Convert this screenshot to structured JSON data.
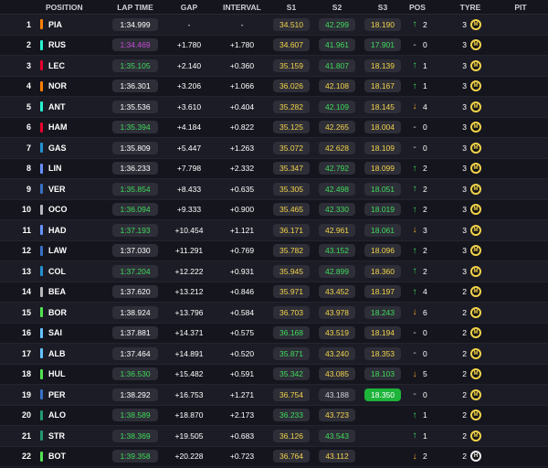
{
  "header": {
    "position": "POSITION",
    "lap_time": "LAP TIME",
    "gap": "GAP",
    "interval": "INTERVAL",
    "s1": "S1",
    "s2": "S2",
    "s3": "S3",
    "pos": "POS",
    "tyre": "TYRE",
    "pit": "PIT"
  },
  "colors": {
    "green": "#3edc5a",
    "yellow": "#f2d34a",
    "purple": "#c74bd9",
    "arrow_up": "#3edc5a",
    "arrow_down": "#f2a72e"
  },
  "rows": [
    {
      "pos": "1",
      "drv": "PIA",
      "team": "#ff8000",
      "lap": "1:34.999",
      "lapc": "white",
      "gap": "-",
      "int": "-",
      "s1": "34.510",
      "s1c": "yellow",
      "s2": "42.299",
      "s2c": "green",
      "s3": "18.190",
      "s3c": "yellow",
      "dir": "up",
      "dp": "2",
      "tyres": "3",
      "tyre": "M"
    },
    {
      "pos": "2",
      "drv": "RUS",
      "team": "#27f4d2",
      "lap": "1:34.469",
      "lapc": "purple",
      "gap": "+1.780",
      "int": "+1.780",
      "s1": "34.607",
      "s1c": "yellow",
      "s2": "41.961",
      "s2c": "green",
      "s3": "17.901",
      "s3c": "green",
      "dir": "none",
      "dp": "0",
      "tyres": "3",
      "tyre": "M"
    },
    {
      "pos": "3",
      "drv": "LEC",
      "team": "#e8002d",
      "lap": "1:35.105",
      "lapc": "green",
      "gap": "+2.140",
      "int": "+0.360",
      "s1": "35.159",
      "s1c": "yellow",
      "s2": "41.807",
      "s2c": "green",
      "s3": "18.139",
      "s3c": "yellow",
      "dir": "up",
      "dp": "1",
      "tyres": "3",
      "tyre": "M"
    },
    {
      "pos": "4",
      "drv": "NOR",
      "team": "#ff8000",
      "lap": "1:36.301",
      "lapc": "white",
      "gap": "+3.206",
      "int": "+1.066",
      "s1": "36.026",
      "s1c": "yellow",
      "s2": "42.108",
      "s2c": "yellow",
      "s3": "18.167",
      "s3c": "yellow",
      "dir": "up",
      "dp": "1",
      "tyres": "3",
      "tyre": "M"
    },
    {
      "pos": "5",
      "drv": "ANT",
      "team": "#27f4d2",
      "lap": "1:35.536",
      "lapc": "white",
      "gap": "+3.610",
      "int": "+0.404",
      "s1": "35.282",
      "s1c": "yellow",
      "s2": "42.109",
      "s2c": "green",
      "s3": "18.145",
      "s3c": "yellow",
      "dir": "down",
      "dp": "4",
      "tyres": "3",
      "tyre": "M"
    },
    {
      "pos": "6",
      "drv": "HAM",
      "team": "#e8002d",
      "lap": "1:35.394",
      "lapc": "green",
      "gap": "+4.184",
      "int": "+0.822",
      "s1": "35.125",
      "s1c": "yellow",
      "s2": "42.265",
      "s2c": "yellow",
      "s3": "18.004",
      "s3c": "yellow",
      "dir": "none",
      "dp": "0",
      "tyres": "3",
      "tyre": "M"
    },
    {
      "pos": "7",
      "drv": "GAS",
      "team": "#2293d1",
      "lap": "1:35.809",
      "lapc": "white",
      "gap": "+5.447",
      "int": "+1.263",
      "s1": "35.072",
      "s1c": "yellow",
      "s2": "42.628",
      "s2c": "yellow",
      "s3": "18.109",
      "s3c": "yellow",
      "dir": "none",
      "dp": "0",
      "tyres": "3",
      "tyre": "M"
    },
    {
      "pos": "8",
      "drv": "LIN",
      "team": "#6692ff",
      "lap": "1:36.233",
      "lapc": "white",
      "gap": "+7.798",
      "int": "+2.332",
      "s1": "35.347",
      "s1c": "yellow",
      "s2": "42.792",
      "s2c": "green",
      "s3": "18.099",
      "s3c": "yellow",
      "dir": "up",
      "dp": "2",
      "tyres": "3",
      "tyre": "M"
    },
    {
      "pos": "9",
      "drv": "VER",
      "team": "#3671c6",
      "lap": "1:35.854",
      "lapc": "green",
      "gap": "+8.433",
      "int": "+0.635",
      "s1": "35.305",
      "s1c": "yellow",
      "s2": "42.498",
      "s2c": "green",
      "s3": "18.051",
      "s3c": "green",
      "dir": "up",
      "dp": "2",
      "tyres": "3",
      "tyre": "M"
    },
    {
      "pos": "10",
      "drv": "OCO",
      "team": "#b6babd",
      "lap": "1:36.094",
      "lapc": "green",
      "gap": "+9.333",
      "int": "+0.900",
      "s1": "35.465",
      "s1c": "yellow",
      "s2": "42.330",
      "s2c": "green",
      "s3": "18.019",
      "s3c": "green",
      "dir": "up",
      "dp": "2",
      "tyres": "3",
      "tyre": "M"
    },
    {
      "pos": "11",
      "drv": "HAD",
      "team": "#6692ff",
      "lap": "1:37.193",
      "lapc": "green",
      "gap": "+10.454",
      "int": "+1.121",
      "s1": "36.171",
      "s1c": "yellow",
      "s2": "42.961",
      "s2c": "yellow",
      "s3": "18.061",
      "s3c": "green",
      "dir": "down",
      "dp": "3",
      "tyres": "3",
      "tyre": "M"
    },
    {
      "pos": "12",
      "drv": "LAW",
      "team": "#3671c6",
      "lap": "1:37.030",
      "lapc": "white",
      "gap": "+11.291",
      "int": "+0.769",
      "s1": "35.782",
      "s1c": "yellow",
      "s2": "43.152",
      "s2c": "green",
      "s3": "18.096",
      "s3c": "yellow",
      "dir": "up",
      "dp": "2",
      "tyres": "3",
      "tyre": "M"
    },
    {
      "pos": "13",
      "drv": "COL",
      "team": "#2293d1",
      "lap": "1:37.204",
      "lapc": "green",
      "gap": "+12.222",
      "int": "+0.931",
      "s1": "35.945",
      "s1c": "yellow",
      "s2": "42.899",
      "s2c": "green",
      "s3": "18.360",
      "s3c": "yellow",
      "dir": "up",
      "dp": "2",
      "tyres": "3",
      "tyre": "M"
    },
    {
      "pos": "14",
      "drv": "BEA",
      "team": "#b6babd",
      "lap": "1:37.620",
      "lapc": "white",
      "gap": "+13.212",
      "int": "+0.846",
      "s1": "35.971",
      "s1c": "yellow",
      "s2": "43.452",
      "s2c": "yellow",
      "s3": "18.197",
      "s3c": "yellow",
      "dir": "up",
      "dp": "4",
      "tyres": "2",
      "tyre": "M"
    },
    {
      "pos": "15",
      "drv": "BOR",
      "team": "#52e252",
      "lap": "1:38.924",
      "lapc": "white",
      "gap": "+13.796",
      "int": "+0.584",
      "s1": "36.703",
      "s1c": "yellow",
      "s2": "43.978",
      "s2c": "yellow",
      "s3": "18.243",
      "s3c": "green",
      "dir": "down",
      "dp": "6",
      "tyres": "2",
      "tyre": "M"
    },
    {
      "pos": "16",
      "drv": "SAI",
      "team": "#64c4ff",
      "lap": "1:37.881",
      "lapc": "white",
      "gap": "+14.371",
      "int": "+0.575",
      "s1": "36.168",
      "s1c": "green",
      "s2": "43.519",
      "s2c": "yellow",
      "s3": "18.194",
      "s3c": "yellow",
      "dir": "none",
      "dp": "0",
      "tyres": "2",
      "tyre": "M"
    },
    {
      "pos": "17",
      "drv": "ALB",
      "team": "#64c4ff",
      "lap": "1:37.464",
      "lapc": "white",
      "gap": "+14.891",
      "int": "+0.520",
      "s1": "35.871",
      "s1c": "green",
      "s2": "43.240",
      "s2c": "yellow",
      "s3": "18.353",
      "s3c": "yellow",
      "dir": "none",
      "dp": "0",
      "tyres": "2",
      "tyre": "M"
    },
    {
      "pos": "18",
      "drv": "HUL",
      "team": "#52e252",
      "lap": "1:36.530",
      "lapc": "green",
      "gap": "+15.482",
      "int": "+0.591",
      "s1": "35.342",
      "s1c": "green",
      "s2": "43.085",
      "s2c": "yellow",
      "s3": "18.103",
      "s3c": "green",
      "dir": "down",
      "dp": "5",
      "tyres": "2",
      "tyre": "M"
    },
    {
      "pos": "19",
      "drv": "PER",
      "team": "#3671c6",
      "lap": "1:38.292",
      "lapc": "white",
      "gap": "+16.753",
      "int": "+1.271",
      "s1": "36.754",
      "s1c": "yellow",
      "s2": "43.188",
      "s2c": "grey",
      "s3": "18.350",
      "s3c": "greenbg",
      "dir": "none",
      "dp": "0",
      "tyres": "2",
      "tyre": "M"
    },
    {
      "pos": "20",
      "drv": "ALO",
      "team": "#229971",
      "lap": "1:38.589",
      "lapc": "green",
      "gap": "+18.870",
      "int": "+2.173",
      "s1": "36.233",
      "s1c": "green",
      "s2": "43.723",
      "s2c": "yellow",
      "s3": "",
      "s3c": "",
      "dir": "up",
      "dp": "1",
      "tyres": "2",
      "tyre": "M"
    },
    {
      "pos": "21",
      "drv": "STR",
      "team": "#229971",
      "lap": "1:38.369",
      "lapc": "green",
      "gap": "+19.505",
      "int": "+0.683",
      "s1": "36.126",
      "s1c": "yellow",
      "s2": "43.543",
      "s2c": "green",
      "s3": "",
      "s3c": "",
      "dir": "up",
      "dp": "1",
      "tyres": "2",
      "tyre": "M"
    },
    {
      "pos": "22",
      "drv": "BOT",
      "team": "#52e252",
      "lap": "1:39.358",
      "lapc": "green",
      "gap": "+20.228",
      "int": "+0.723",
      "s1": "36.764",
      "s1c": "yellow",
      "s2": "43.112",
      "s2c": "yellow",
      "s3": "",
      "s3c": "",
      "dir": "down",
      "dp": "2",
      "tyres": "2",
      "tyre": "H"
    }
  ]
}
